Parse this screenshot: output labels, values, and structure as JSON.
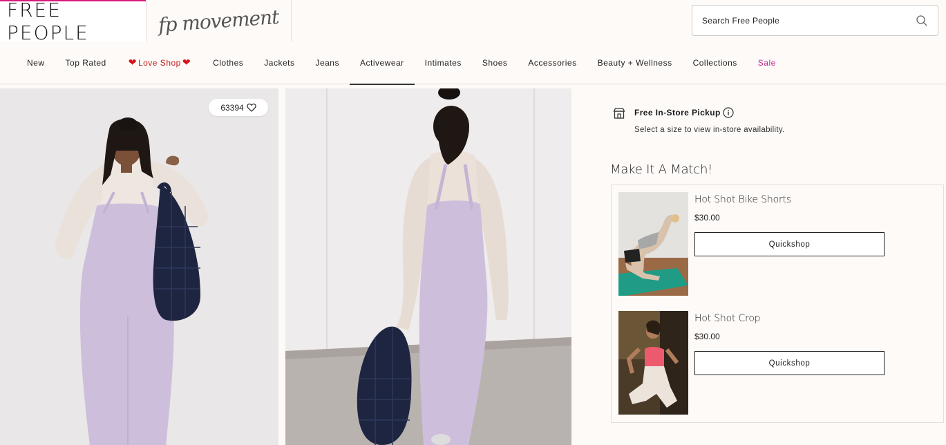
{
  "header": {
    "brand": "FREE PEOPLE",
    "sub_brand": "fp movement",
    "search": {
      "placeholder": "Search Free People",
      "value": ""
    }
  },
  "nav": {
    "items": [
      {
        "label": "New"
      },
      {
        "label": "Top Rated"
      },
      {
        "label": "Love Shop"
      },
      {
        "label": "Clothes"
      },
      {
        "label": "Jackets"
      },
      {
        "label": "Jeans"
      },
      {
        "label": "Activewear",
        "active": true
      },
      {
        "label": "Intimates"
      },
      {
        "label": "Shoes"
      },
      {
        "label": "Accessories"
      },
      {
        "label": "Beauty + Wellness"
      },
      {
        "label": "Collections"
      },
      {
        "label": "Sale"
      }
    ],
    "sale_color": "#c0278a",
    "love_color": "#c41b1b"
  },
  "gallery": {
    "favorites_count": "63394"
  },
  "pickup": {
    "title": "Free In-Store Pickup",
    "note": "Select a size to view in-store availability."
  },
  "match": {
    "heading": "Make It A Match!",
    "products": [
      {
        "name": "Hot Shot Bike Shorts",
        "price": "$30.00",
        "button": "Quickshop"
      },
      {
        "name": "Hot Shot Crop",
        "price": "$30.00",
        "button": "Quickshop"
      }
    ]
  },
  "colors": {
    "accent": "#d6197b",
    "lavender": "#c9bcd6"
  }
}
